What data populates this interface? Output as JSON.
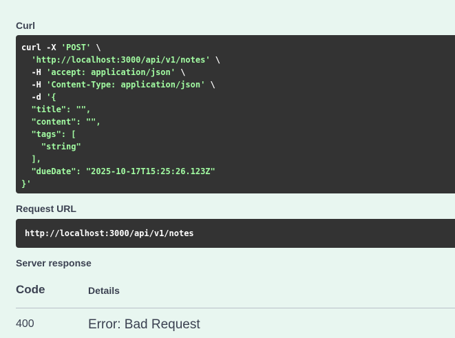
{
  "curl": {
    "label": "Curl",
    "lines": [
      {
        "a": "curl -X ",
        "b": "'POST'",
        "c": " \\"
      },
      {
        "a": "  ",
        "b": "'http://localhost:3000/api/v1/notes'",
        "c": " \\"
      },
      {
        "a": "  -H ",
        "b": "'accept: application/json'",
        "c": " \\"
      },
      {
        "a": "  -H ",
        "b": "'Content-Type: application/json'",
        "c": " \\"
      },
      {
        "a": "  -d ",
        "b": "'{",
        "c": ""
      },
      {
        "a": "",
        "b": "  \"title\": \"\",",
        "c": ""
      },
      {
        "a": "",
        "b": "  \"content\": \"\",",
        "c": ""
      },
      {
        "a": "",
        "b": "  \"tags\": [",
        "c": ""
      },
      {
        "a": "",
        "b": "    \"string\"",
        "c": ""
      },
      {
        "a": "",
        "b": "  ],",
        "c": ""
      },
      {
        "a": "",
        "b": "  \"dueDate\": \"2025-10-17T15:25:26.123Z\"",
        "c": ""
      },
      {
        "a": "",
        "b": "}'",
        "c": ""
      }
    ]
  },
  "request_url": {
    "label": "Request URL",
    "value": "http://localhost:3000/api/v1/notes"
  },
  "server_response": {
    "label": "Server response",
    "columns": {
      "code": "Code",
      "details": "Details"
    },
    "rows": [
      {
        "code": "400",
        "details": "Error: Bad Request"
      }
    ]
  },
  "colors": {
    "background": "#e8f6f0",
    "code_bg": "#333333",
    "code_string": "#a2fca2",
    "text": "#3b4151"
  }
}
